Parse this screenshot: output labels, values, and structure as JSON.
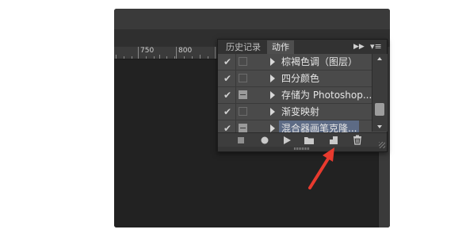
{
  "ruler": {
    "marks": [
      "750",
      "800"
    ]
  },
  "panel": {
    "tabs": [
      {
        "label": "历史记录",
        "active": false
      },
      {
        "label": "动作",
        "active": true
      }
    ],
    "controls": {
      "play_icon": "double-chevron-right-icon",
      "menu_icon": "panel-menu-icon"
    },
    "actions": [
      {
        "label": "棕褐色调（图层）",
        "checked": true,
        "dialog": false
      },
      {
        "label": "四分颜色",
        "checked": true,
        "dialog": false
      },
      {
        "label": "存储为 Photoshop...",
        "checked": true,
        "dialog": true
      },
      {
        "label": "渐变映射",
        "checked": true,
        "dialog": false
      },
      {
        "label": "混合器画笔克隆...",
        "checked": true,
        "dialog": true,
        "selected": true
      }
    ],
    "toolbar": {
      "stop": "stop-icon",
      "record": "record-icon",
      "play": "play-icon",
      "new_set": "folder-icon",
      "new_action": "new-action-icon",
      "delete": "trash-icon"
    }
  },
  "annotation": {
    "arrow_color": "#e83a2e"
  }
}
